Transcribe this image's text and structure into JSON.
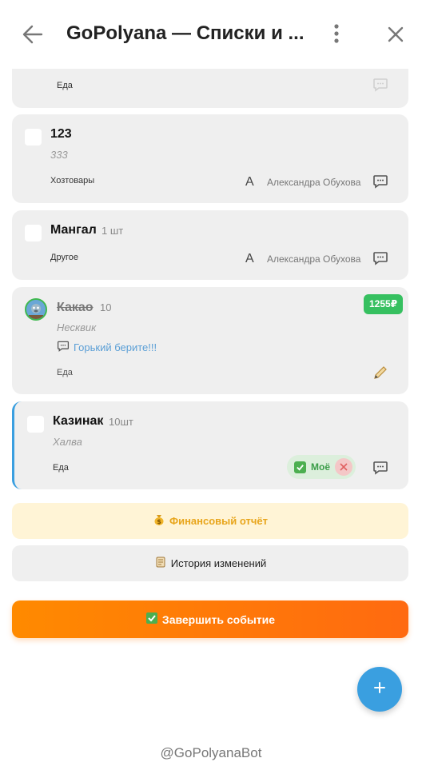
{
  "header": {
    "title": "GoPolyana — Списки и ..."
  },
  "items": [
    {
      "category": "Еда"
    },
    {
      "name": "123",
      "subtitle": "333",
      "category": "Хозтовары",
      "assignee_initial": "А",
      "assignee": "Александра Обухова"
    },
    {
      "name": "Мангал",
      "qty": "1 шт",
      "category": "Другое",
      "assignee_initial": "А",
      "assignee": "Александра Обухова"
    },
    {
      "name": "Какао",
      "qty": "10",
      "subtitle": "Несквик",
      "comment": "Горький берите!!!",
      "category": "Еда",
      "price": "1255₽"
    },
    {
      "name": "Казинак",
      "qty": "10шт",
      "subtitle": "Халва",
      "category": "Еда",
      "mine_label": "Моё"
    }
  ],
  "actions": {
    "finance_label": "Финансовый отчёт",
    "history_label": "История изменений",
    "finish_label": "Завершить событие"
  },
  "footer": {
    "bot_handle": "@GoPolyanaBot"
  },
  "colors": {
    "accent": "#3a9fe0",
    "finish_gradient_start": "#ff8a00",
    "finish_gradient_end": "#ff6a10",
    "price_badge": "#36c060",
    "finance_bg": "#fff4d6",
    "finance_text": "#e8a51b",
    "card_bg": "#efefef"
  }
}
